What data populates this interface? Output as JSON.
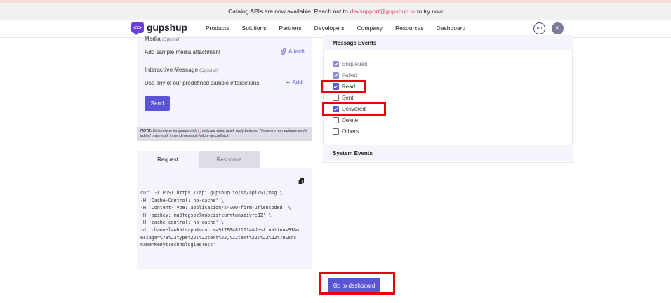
{
  "banner": {
    "text_before": "Catalog APIs are now available. Reach out to",
    "email": "devsupport@gupshup.io",
    "text_after": "to try now"
  },
  "nav": {
    "logo_text": "gupshup",
    "items": [
      "Products",
      "Solutions",
      "Partners",
      "Developers",
      "Company",
      "Resources",
      "Dashboard"
    ],
    "lang": "en",
    "avatar_initial": "K"
  },
  "left": {
    "media_label": "Media",
    "media_optional": "(Optional)",
    "media_text": "Add sample media attachment",
    "attach_label": "Attach",
    "interactive_label": "Interactive Message",
    "interactive_optional": "(Optional)",
    "interactive_text": "Use any of our predefined sample interactions",
    "add_label": "Add",
    "send_label": "Send",
    "note_bold": "NOTE:",
    "note_line1": "Button-type templates with",
    "note_brackets": "{ }",
    "note_line1b": "indicate static quick reply buttons. These are non",
    "note_line2": "editable and if edited may result in send message failure on callback"
  },
  "tabs": {
    "request": "Request",
    "response": "Response"
  },
  "code": {
    "lines": [
      "curl -X POST https://api.gupshup.io/sm/api/v1/msg \\",
      "-H 'Cache-Control: no-cache' \\",
      "-H 'Content-Type: application/x-www-form-urlencoded' \\",
      "-H 'apikey: mu6fogspz7mubcisfcurmtanszivre32' \\",
      "-H 'cache-control: no-cache' \\",
      "-d 'channel=whatsapp&source=917834811114&destination=91&m",
      "essage=%7B%22type%22:%22text%22,%22text%22:%22%22%7D&src.",
      "name=KenytTechnologiesTest'"
    ]
  },
  "events": {
    "message_header": "Message Events",
    "system_header": "System Events",
    "items": [
      {
        "label": "Enqueued",
        "checked": true,
        "dim": true
      },
      {
        "label": "Failed",
        "checked": true,
        "dim": true
      },
      {
        "label": "Read",
        "checked": true,
        "dim": false
      },
      {
        "label": "Sent",
        "checked": false,
        "dim": false
      },
      {
        "label": "Delivered",
        "checked": true,
        "dim": false
      },
      {
        "label": "Delete",
        "checked": false,
        "dim": false
      },
      {
        "label": "Others",
        "checked": false,
        "dim": false
      }
    ]
  },
  "footer": {
    "dashboard_button": "Go to dashboard"
  },
  "colors": {
    "accent": "#5b55d6",
    "highlight": "#e8000a",
    "link": "#e24b6b"
  }
}
